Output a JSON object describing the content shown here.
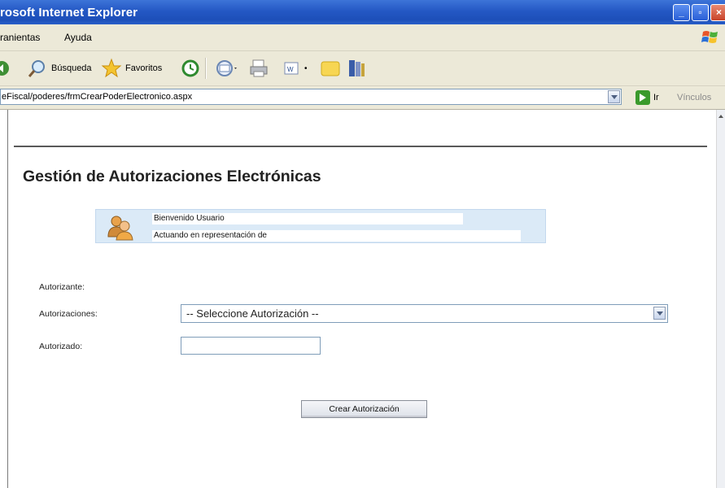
{
  "window": {
    "title": "rosoft Internet Explorer",
    "controls": {
      "minimize": "_",
      "maximize": "▫",
      "close": "×"
    }
  },
  "menubar": {
    "items": [
      "ranientas",
      "Ayuda"
    ]
  },
  "toolbar": {
    "back_icon": "back-arrow-icon",
    "search_label": "Búsqueda",
    "favorites_label": "Favoritos",
    "icons": [
      "search-icon",
      "star-icon",
      "history-icon",
      "mail-icon",
      "print-icon",
      "edit-icon",
      "folder-icon",
      "research-icon"
    ]
  },
  "addressbar": {
    "url": "eFiscal/poderes/frmCrearPoderElectronico.aspx",
    "go_label": "Ir",
    "links_label": "Vínculos"
  },
  "page": {
    "heading": "Gestión de Autorizaciones Electrónicas",
    "welcome": {
      "greeting": "Bienvenido Usuario",
      "representation": "Actuando en representación de"
    },
    "form": {
      "autorizante_label": "Autorizante:",
      "autorizaciones_label": "Autorizaciones:",
      "autorizaciones_selected": "-- Seleccione Autorización --",
      "autorizado_label": "Autorizado:",
      "autorizado_value": ""
    },
    "submit_label": "Crear Autorización"
  },
  "colors": {
    "titlebar": "#2458c4",
    "chrome": "#ece9d8",
    "welcome_bg": "#dbeaf7",
    "input_border": "#7f9db9"
  }
}
